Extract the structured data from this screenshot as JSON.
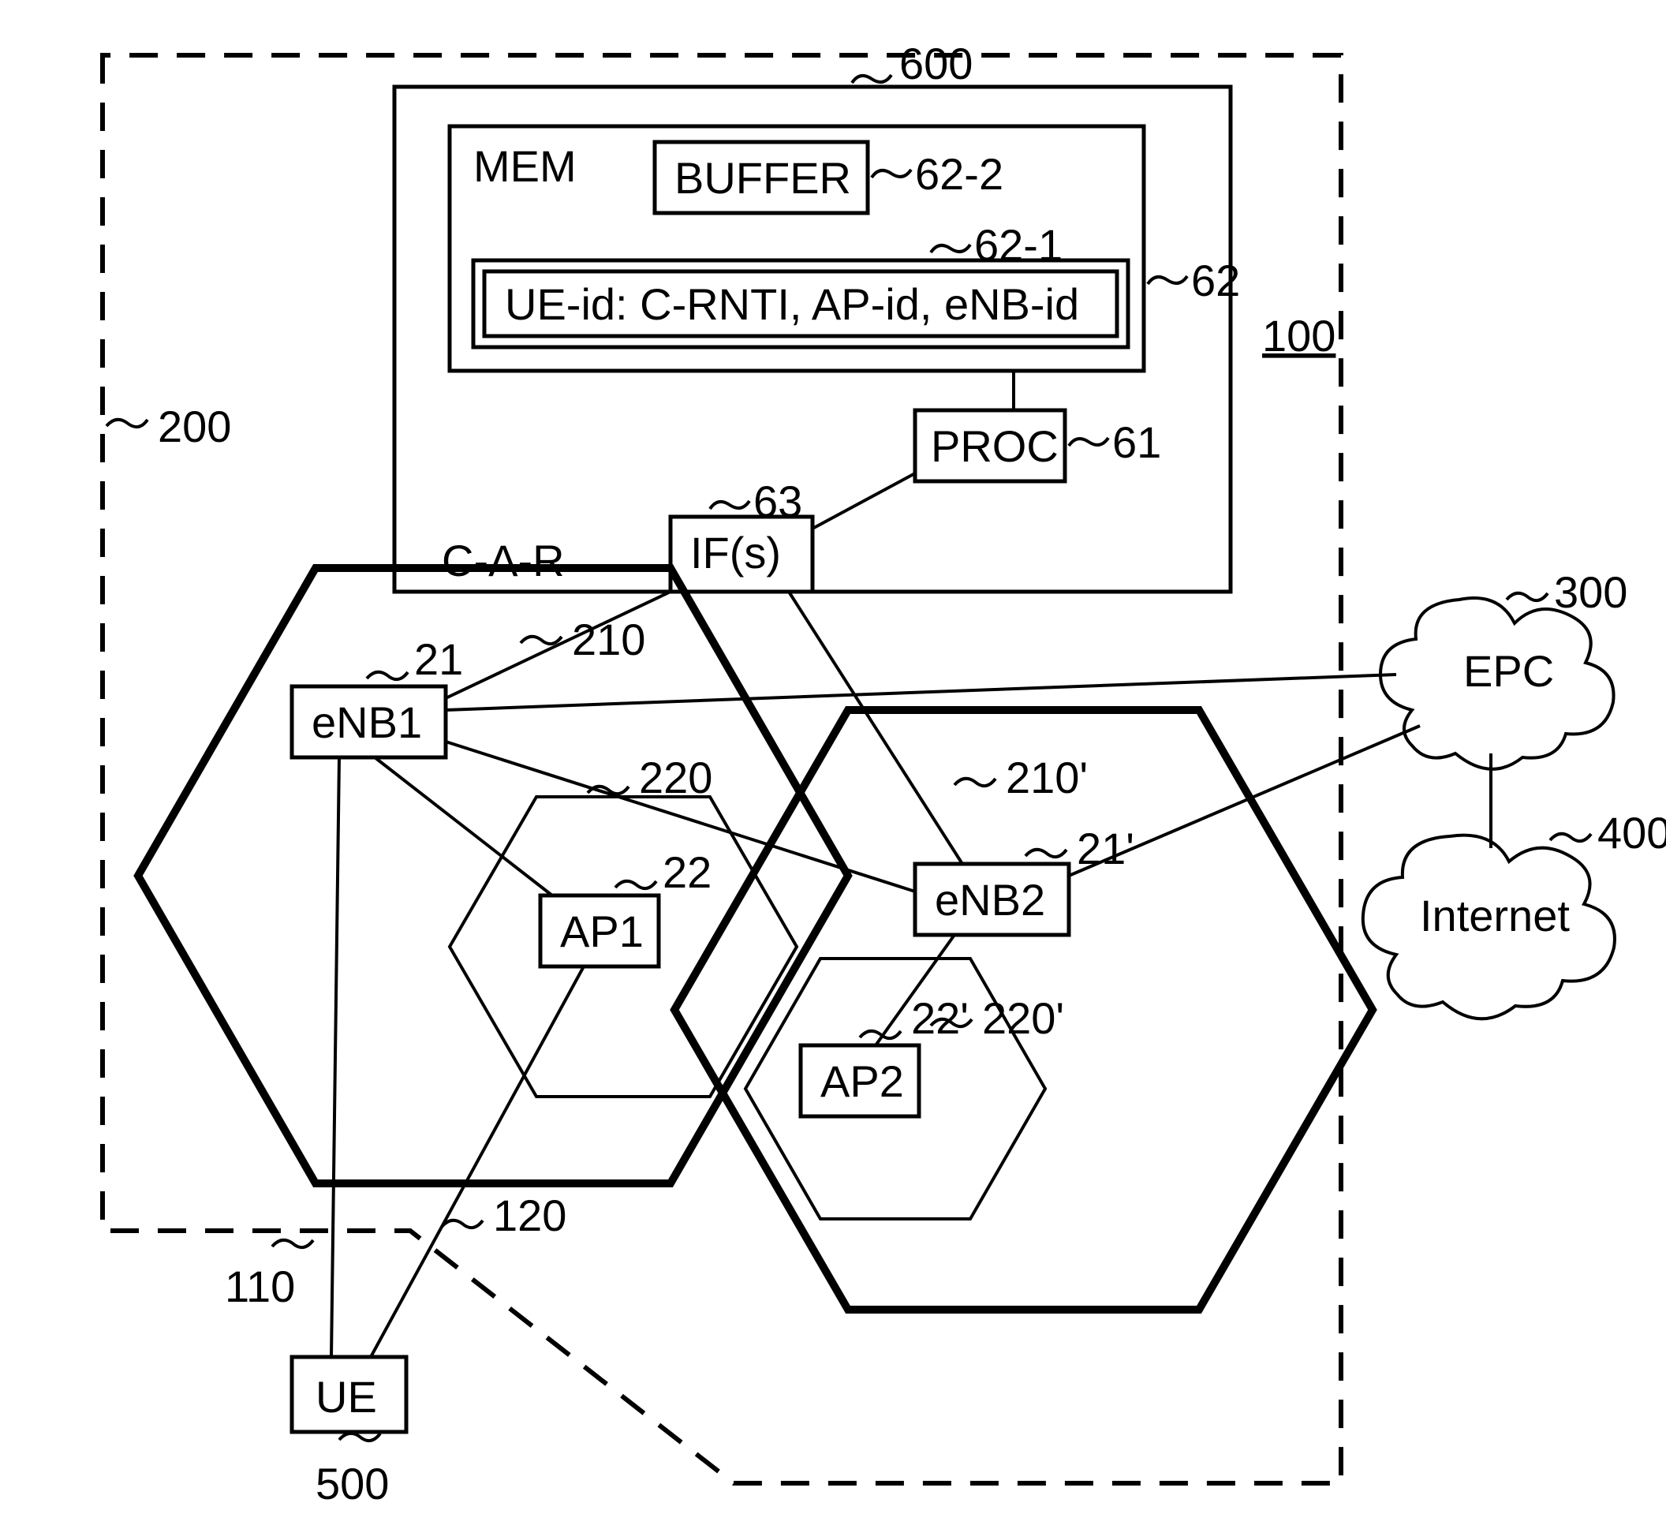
{
  "system": {
    "ref": "100"
  },
  "boundary": {
    "ref": "200"
  },
  "car": {
    "label": "C-A-R",
    "ref": "600",
    "mem": {
      "label": "MEM",
      "ref": "62",
      "buffer": {
        "label": "BUFFER",
        "ref": "62-2"
      },
      "record": {
        "label": "UE-id: C-RNTI, AP-id, eNB-id",
        "ref": "62-1"
      }
    },
    "proc": {
      "label": "PROC",
      "ref": "61"
    },
    "ifs": {
      "label": "IF(s)",
      "ref": "63"
    }
  },
  "cells": {
    "cell1": {
      "ref": "210",
      "enb": {
        "label": "eNB1",
        "ref": "21"
      },
      "ap_cell": {
        "ref": "220",
        "ap": {
          "label": "AP1",
          "ref": "22"
        }
      }
    },
    "cell2": {
      "ref": "210'",
      "enb": {
        "label": "eNB2",
        "ref": "21'"
      },
      "ap_cell": {
        "ref": "220'",
        "ap": {
          "label": "AP2",
          "ref": "22'"
        }
      }
    }
  },
  "ue": {
    "label": "UE",
    "ref": "500"
  },
  "links": {
    "ue_enb1": "110",
    "ue_ap1": "120"
  },
  "epc": {
    "label": "EPC",
    "ref": "300"
  },
  "internet": {
    "label": "Internet",
    "ref": "400"
  }
}
